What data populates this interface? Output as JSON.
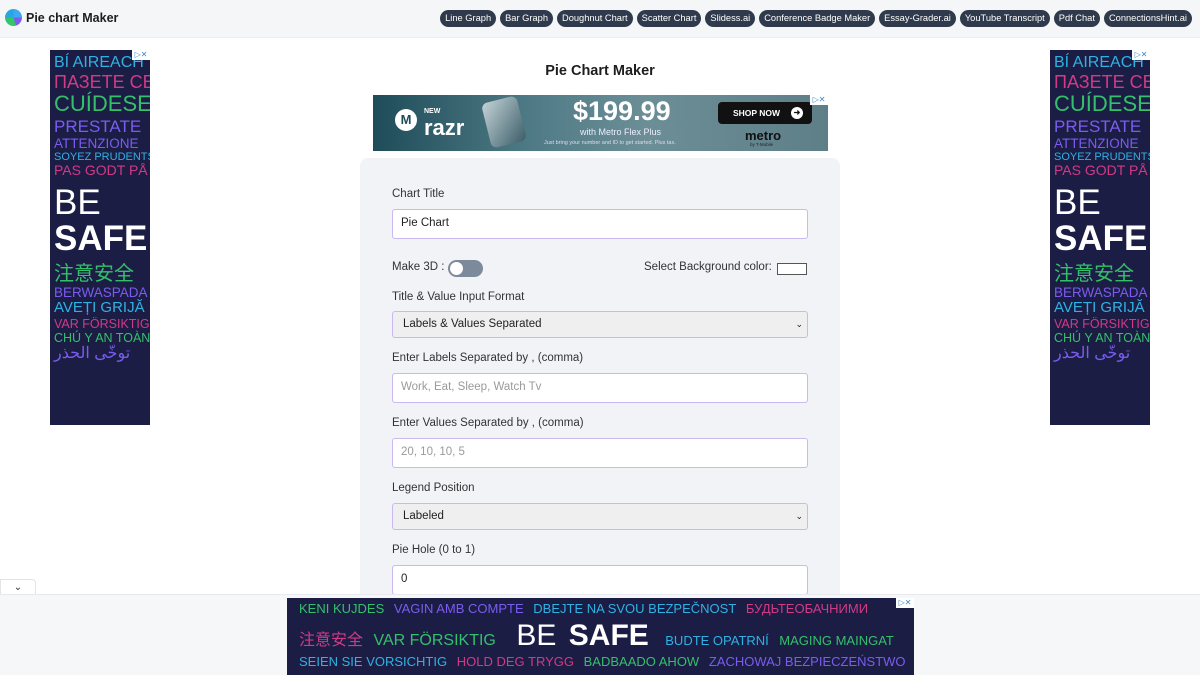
{
  "brand": {
    "name": "Pie chart Maker"
  },
  "nav": [
    "Line Graph",
    "Bar Graph",
    "Doughnut Chart",
    "Scatter Chart",
    "Slidess.ai",
    "Conference Badge Maker",
    "Essay-Grader.ai",
    "YouTube Transcript",
    "Pdf Chat",
    "ConnectionsHint.ai"
  ],
  "page_title": "Pie Chart Maker",
  "ad_close": "▷✕",
  "top_ad": {
    "new": "NEW",
    "product": "razr",
    "price": "$199.99",
    "sub": "with Metro Flex Plus",
    "fine": "Just bring your number and ID to get started. Plus tax.",
    "cta": "SHOP NOW",
    "brand": "metro",
    "brand_sub": "by T-Mobile"
  },
  "side_ad": {
    "lines": [
      "BÍ AIREACH",
      "ПАЗЕТЕ СЕ",
      "CUÍDESE",
      "PRESTATE",
      "ATTENZIONE",
      "SOYEZ PRUDENTS",
      "PAS GODT PÅ"
    ],
    "be": "BE",
    "safe": "SAFE",
    "lines2": [
      "注意安全",
      "BERWASPADA",
      "AVEȚI GRIJĂ",
      "VAR FÖRSIKTIG",
      "CHÚ Y AN TOÀN",
      "توخّى الحذر"
    ]
  },
  "form": {
    "chart_title_label": "Chart Title",
    "chart_title_value": "Pie Chart",
    "make3d_label": "Make 3D :",
    "make3d_on": false,
    "bg_color_label": "Select Background color:",
    "bg_color": "#ffffff",
    "input_format_label": "Title & Value Input Format",
    "input_format_value": "Labels & Values Separated",
    "labels_label": "Enter Labels Separated by , (comma)",
    "labels_placeholder": "Work, Eat, Sleep, Watch Tv",
    "values_label": "Enter Values Separated by , (comma)",
    "values_placeholder": "20, 10, 10, 5",
    "legend_label": "Legend Position",
    "legend_value": "Labeled",
    "hole_label": "Pie Hole (0 to 1)",
    "hole_value": "0"
  },
  "bottom_ad": {
    "row1": [
      "KENI KUJDES",
      "VAGIN AMB COMPTE",
      "DBEJTE NA SVOU BEZPEČNOST",
      "БУДЬТЕОБАЧНИМИ"
    ],
    "row2a": [
      "注意安全",
      "VAR FÖRSIKTIG"
    ],
    "be": "BE",
    "safe": "SAFE",
    "row2b": [
      "BUDTE OPATRNÍ",
      "MAGING MAINGAT"
    ],
    "row3": [
      "SEIEN SIE VORSICHTIG",
      "HOLD DEG TRYGG",
      "BADBAADO AHOW",
      "ZACHOWAJ BEZPIECZEŃSTWO"
    ]
  },
  "colors": {
    "ad_bg": "#1b1d45",
    "nav_pill": "#2f3b4c",
    "input_border": "#c9b8f2",
    "toggle_off": "#7d8a9c"
  }
}
